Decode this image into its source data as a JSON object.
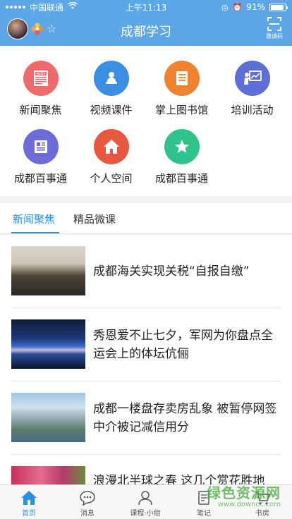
{
  "status_bar": {
    "carrier": "中国联通",
    "time": "上午11:13",
    "battery": "91%",
    "battery_level": 0.91
  },
  "header": {
    "title": "成都学习",
    "scan_label": "邀请码"
  },
  "grid": [
    {
      "label": "新闻聚焦",
      "icon": "newspaper-icon",
      "color": "#ef6a6a"
    },
    {
      "label": "视频课件",
      "icon": "presenter-icon",
      "color": "#3a8fe3"
    },
    {
      "label": "掌上图书馆",
      "icon": "book-icon",
      "color": "#f0832f"
    },
    {
      "label": "培训活动",
      "icon": "training-board-icon",
      "color": "#5d6fd6"
    },
    {
      "label": "成都百事通",
      "icon": "document-icon",
      "color": "#6d6bd6"
    },
    {
      "label": "个人空间",
      "icon": "home-icon",
      "color": "#e8573f"
    },
    {
      "label": "成都百事通",
      "icon": "star-icon",
      "color": "#2fc38b"
    }
  ],
  "tabs": [
    {
      "label": "新闻聚焦",
      "active": true
    },
    {
      "label": "精品微课",
      "active": false
    }
  ],
  "news": [
    {
      "title": "成都海关实现关税“自报自缴”"
    },
    {
      "title": "秀恩爱不止七夕，军网为你盘点全运会上的体坛伉俪"
    },
    {
      "title": "成都一楼盘存卖房乱象 被暂停网签中介被记减信用分"
    },
    {
      "title": "浪漫北半球之春 这几个赏花胜地"
    }
  ],
  "bottom_nav": [
    {
      "label": "首页",
      "icon": "home-icon",
      "active": true
    },
    {
      "label": "消息",
      "icon": "chat-bubble-icon",
      "active": false
    },
    {
      "label": "课程·小组",
      "icon": "person-icon",
      "active": false
    },
    {
      "label": "笔记",
      "icon": "note-icon",
      "active": false
    },
    {
      "label": "书房",
      "icon": "cart-icon",
      "active": false
    }
  ],
  "watermark": {
    "main": "绿色资源网",
    "sub": "www.downcc.com"
  },
  "colors": {
    "brand": "#5ea7e6",
    "accent": "#2f8fe0"
  }
}
